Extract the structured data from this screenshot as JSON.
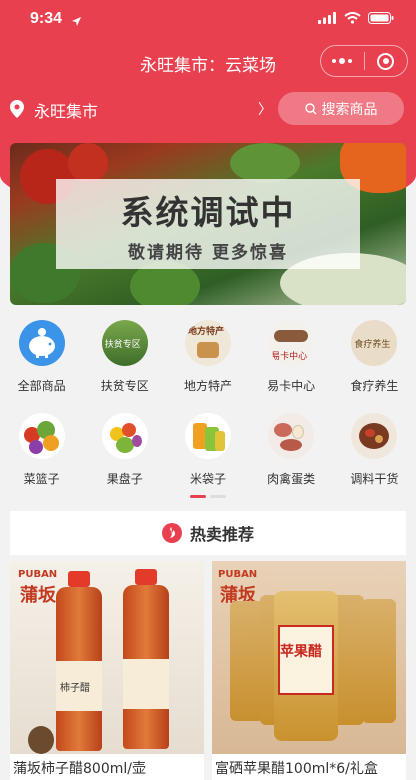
{
  "status": {
    "time": "9:34"
  },
  "nav": {
    "title": "永旺集市：云菜场"
  },
  "location": {
    "name": "永旺集市",
    "arrow": "〉"
  },
  "search": {
    "label": "搜索商品"
  },
  "banner": {
    "title": "系统调试中",
    "subtitle": "敬请期待 更多惊喜"
  },
  "categories": [
    {
      "label": "全部商品",
      "icon": "piggy-bank-icon",
      "badge": ""
    },
    {
      "label": "扶贫专区",
      "icon": "poverty-relief-icon",
      "badge": "扶贫专区"
    },
    {
      "label": "地方特产",
      "icon": "local-specialty-icon",
      "badge": "地方特产"
    },
    {
      "label": "易卡中心",
      "icon": "handshake-icon",
      "badge": "易卡中心"
    },
    {
      "label": "食疗养生",
      "icon": "health-food-icon",
      "badge": "食疗养生"
    },
    {
      "label": "菜篮子",
      "icon": "vegetable-basket-icon",
      "badge": ""
    },
    {
      "label": "果盘子",
      "icon": "fruit-plate-icon",
      "badge": ""
    },
    {
      "label": "米袋子",
      "icon": "rice-bag-icon",
      "badge": ""
    },
    {
      "label": "肉禽蛋类",
      "icon": "meat-eggs-icon",
      "badge": ""
    },
    {
      "label": "调料干货",
      "icon": "spices-icon",
      "badge": ""
    }
  ],
  "hot": {
    "label": "热卖推荐"
  },
  "products": [
    {
      "name": "蒲坂柿子醋800ml/壶",
      "brand": "蒲坂",
      "brand_latin": "PUBAN",
      "bottle_label": "柿子醋"
    },
    {
      "name": "富硒苹果醋100ml*6/礼盒",
      "brand": "蒲坂",
      "brand_latin": "PUBAN",
      "bottle_label": "苹果醋"
    }
  ],
  "colors": {
    "brand": "#e8404f"
  }
}
